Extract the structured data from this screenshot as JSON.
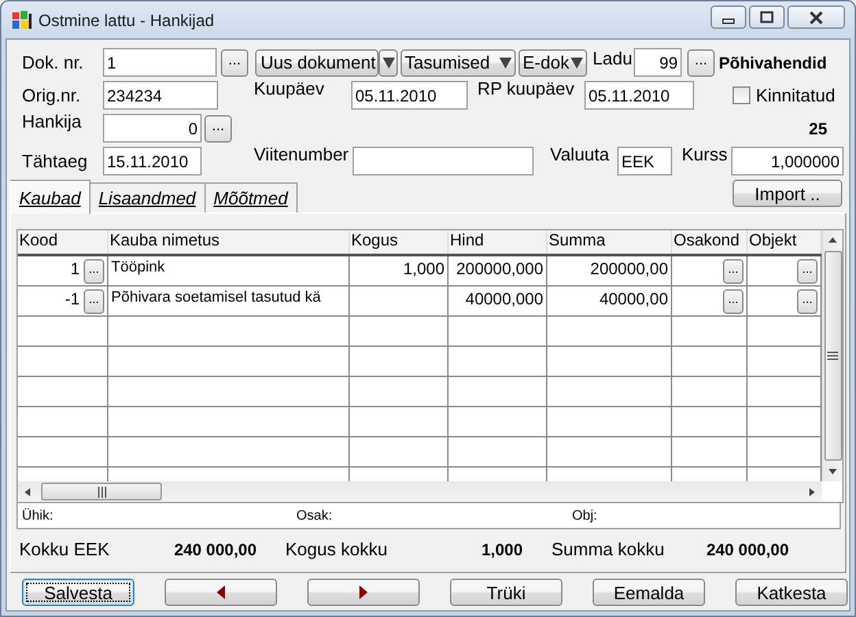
{
  "window": {
    "title": "Ostmine lattu - Hankijad"
  },
  "header": {
    "dok_nr": {
      "label": "Dok. nr.",
      "value": "1",
      "browse": "..."
    },
    "uus_dokument": "Uus dokument",
    "tasumised": "Tasumised",
    "e_dok": "E-dok",
    "ladu": {
      "label": "Ladu",
      "value": "99",
      "browse": "...",
      "name": "Põhivahendid"
    },
    "orig_nr": {
      "label": "Orig.nr.",
      "value": "234234"
    },
    "kuupaev": {
      "label": "Kuupäev",
      "value": "05.11.2010"
    },
    "rp_kuupaev": {
      "label": "RP kuupäev",
      "value": "05.11.2010"
    },
    "kinnitatud": {
      "label": "Kinnitatud",
      "checked": false
    },
    "hankija": {
      "label": "Hankija",
      "value": "0",
      "browse": "..."
    },
    "count": "25",
    "tahtaeg": {
      "label": "Tähtaeg",
      "value": "15.11.2010"
    },
    "viitenumber": {
      "label": "Viitenumber"
    },
    "valuuta": {
      "label": "Valuuta",
      "value": "EEK"
    },
    "kurss": {
      "label": "Kurss",
      "value": "1,000000"
    }
  },
  "tabs": [
    {
      "label": "Kaubad",
      "selected": true
    },
    {
      "label": "Lisaandmed",
      "selected": false
    },
    {
      "label": "Mõõtmed",
      "selected": false
    }
  ],
  "import_button": "Import ..",
  "table": {
    "columns": [
      "Kood",
      "Kauba nimetus",
      "Kogus",
      "Hind",
      "Summa",
      "Osakond",
      "Objekt"
    ],
    "rows": [
      {
        "kood": "1",
        "browse": "...",
        "name": "Tööpink",
        "kogus": "1,000",
        "hind": "200000,000",
        "summa": "200000,00",
        "osakond_browse": "...",
        "objekt_browse": "..."
      },
      {
        "kood": "-1",
        "browse": "...",
        "name": "Põhivara soetamisel tasutud kä",
        "hind": "40000,000",
        "summa": "40000,00",
        "osakond_browse": "...",
        "objekt_browse": "..."
      }
    ]
  },
  "info": {
    "uhik": "Ühik:",
    "osak": "Osak:",
    "obj": "Obj:"
  },
  "totals": [
    {
      "label": "Kokku EEK",
      "value": "240 000,00"
    },
    {
      "label": "Kogus kokku",
      "value": "1,000"
    },
    {
      "label": "Summa kokku",
      "value": "240 000,00"
    }
  ],
  "buttons": [
    {
      "kind": "text",
      "label": "Salvesta",
      "focused": true
    },
    {
      "kind": "prev",
      "focused": false
    },
    {
      "kind": "next",
      "focused": false
    },
    {
      "kind": "text",
      "label": "Trüki",
      "focused": false
    },
    {
      "kind": "text",
      "label": "Eemalda",
      "focused": false
    },
    {
      "kind": "text",
      "label": "Katkesta",
      "focused": false
    }
  ]
}
